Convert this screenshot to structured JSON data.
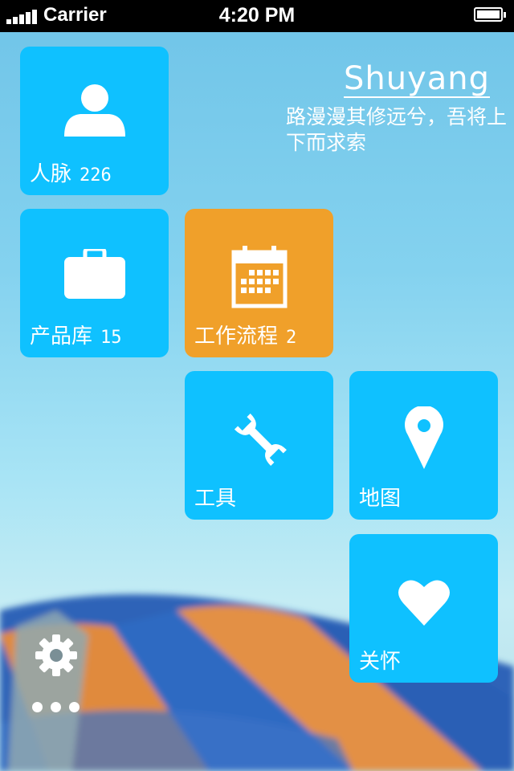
{
  "status_bar": {
    "carrier": "Carrier",
    "time": "4:20 PM"
  },
  "profile": {
    "name": "Shuyang",
    "motto": "路漫漫其修远兮，吾将上下而求索"
  },
  "tiles": [
    {
      "label": "人脉",
      "count": "226",
      "icon": "person-icon",
      "color": "#0fc1ff"
    },
    {
      "label": "产品库",
      "count": "15",
      "icon": "briefcase-icon",
      "color": "#0fc1ff"
    },
    {
      "label": "工作流程",
      "count": "2",
      "icon": "calendar-icon",
      "color": "#f0a02a"
    },
    {
      "label": "工具",
      "count": "",
      "icon": "wrench-icon",
      "color": "#0fc1ff"
    },
    {
      "label": "地图",
      "count": "",
      "icon": "map-pin-icon",
      "color": "#0fc1ff"
    },
    {
      "label": "关怀",
      "count": "",
      "icon": "heart-icon",
      "color": "#0fc1ff"
    }
  ],
  "controls": {
    "settings_icon": "gear-icon",
    "more_icon": "more-dots-icon"
  }
}
